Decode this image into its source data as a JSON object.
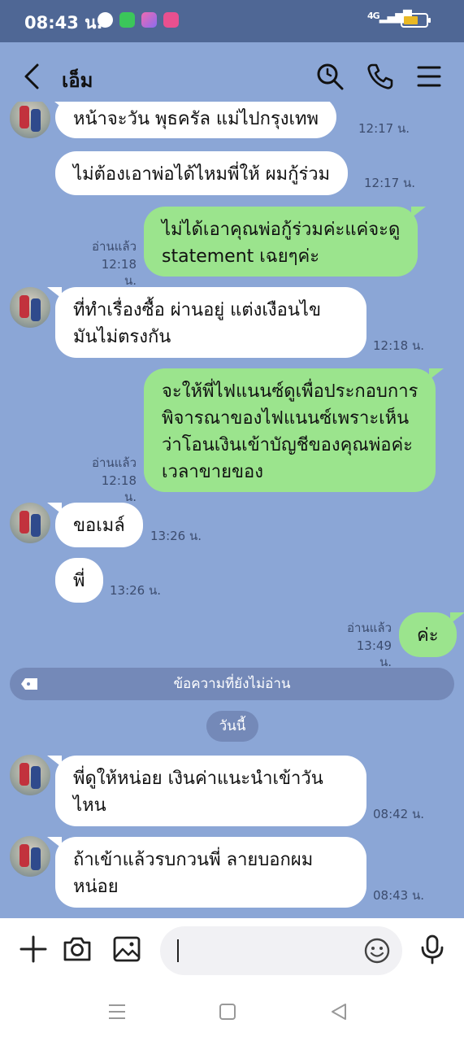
{
  "status_bar": {
    "time": "08:43 น.",
    "network": "4G"
  },
  "header": {
    "contact_name": "เอ็ม",
    "icons": [
      "back-icon",
      "search-icon",
      "phone-icon",
      "menu-icon"
    ]
  },
  "messages": [
    {
      "side": "left",
      "lines": [
        "หน้าจะวัน  พุธครัล  แม่ไปกรุงเทพ"
      ],
      "time": "12:17 น."
    },
    {
      "side": "left",
      "lines": [
        "ไม่ต้องเอาพ่อได้ไหมพี่ให้ ผมกู้ร่วม"
      ],
      "time": "12:17 น."
    },
    {
      "side": "right",
      "lines": [
        "ไม่ได้เอาคุณพ่อกู้ร่วมค่ะแค่จะดู",
        "statement เฉยๆค่ะ"
      ],
      "read": "อ่านแล้ว",
      "time": "12:18 น."
    },
    {
      "side": "left",
      "lines": [
        "ที่ทำเรื่องซื้อ  ผ่านอยู่  แต่งเงือนไข",
        "มันไม่ตรงกัน"
      ],
      "time": "12:18 น."
    },
    {
      "side": "right",
      "lines": [
        "จะให้พี่ไฟแนนซ์ดูเพื่อประกอบการ",
        "พิจารณาของไฟแนนซ์เพราะเห็น",
        "ว่าโอนเงินเข้าบัญชีของคุณพ่อค่ะ",
        "เวลาขายของ"
      ],
      "read": "อ่านแล้ว",
      "time": "12:18 น."
    },
    {
      "side": "left",
      "lines": [
        "ขอเมล์"
      ],
      "time": "13:26 น."
    },
    {
      "side": "left",
      "lines": [
        "พี่"
      ],
      "time": "13:26 น."
    },
    {
      "side": "right",
      "lines": [
        "ค่ะ"
      ],
      "read": "อ่านแล้ว",
      "time": "13:49 น."
    },
    {
      "side": "left",
      "lines": [
        "พี่ดูให้หน่อย  เงินค่าแนะนำเข้าวัน",
        "ไหน"
      ],
      "time": "08:42 น."
    },
    {
      "side": "left",
      "lines": [
        "ถ้าเข้าแล้วรบกวนพี่ ลายบอกผม",
        "หน่อย"
      ],
      "time": "08:43 น."
    }
  ],
  "unread_divider": "ข้อความที่ยังไม่อ่าน",
  "date_divider": "วันนี้",
  "input": {
    "value": "",
    "placeholder": ""
  },
  "colors": {
    "chat_background": "#8ba6d6",
    "status_bar": "#4f6795",
    "my_bubble": "#9be48d",
    "their_bubble": "#ffffff"
  }
}
